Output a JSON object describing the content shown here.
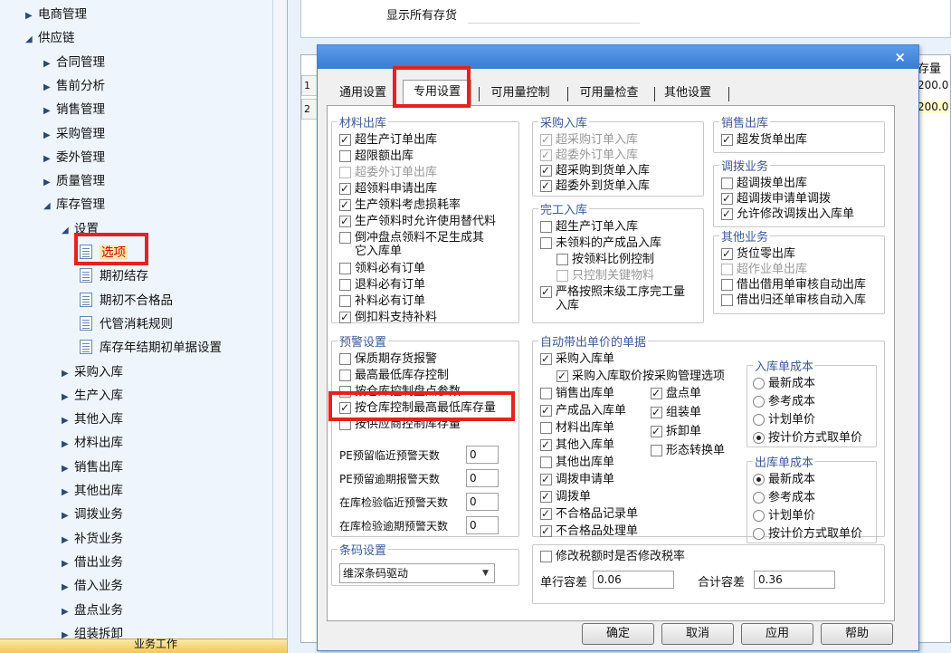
{
  "tree": {
    "items": [
      {
        "label": "电商管理",
        "arrow": "▶"
      },
      {
        "label": "供应链",
        "arrow": "◢"
      },
      {
        "label": "合同管理",
        "arrow": "▶"
      },
      {
        "label": "售前分析",
        "arrow": "▶"
      },
      {
        "label": "销售管理",
        "arrow": "▶"
      },
      {
        "label": "采购管理",
        "arrow": "▶"
      },
      {
        "label": "委外管理",
        "arrow": "▶"
      },
      {
        "label": "质量管理",
        "arrow": "▶"
      },
      {
        "label": "库存管理",
        "arrow": "◢"
      },
      {
        "label": "设置",
        "arrow": "◢"
      },
      {
        "label": "选项",
        "arrow": ""
      },
      {
        "label": "期初结存",
        "arrow": ""
      },
      {
        "label": "期初不合格品",
        "arrow": ""
      },
      {
        "label": "代管消耗规则",
        "arrow": ""
      },
      {
        "label": "库存年结期初单据设置",
        "arrow": ""
      },
      {
        "label": "采购入库",
        "arrow": "▶"
      },
      {
        "label": "生产入库",
        "arrow": "▶"
      },
      {
        "label": "其他入库",
        "arrow": "▶"
      },
      {
        "label": "材料出库",
        "arrow": "▶"
      },
      {
        "label": "销售出库",
        "arrow": "▶"
      },
      {
        "label": "其他出库",
        "arrow": "▶"
      },
      {
        "label": "调拨业务",
        "arrow": "▶"
      },
      {
        "label": "补货业务",
        "arrow": "▶"
      },
      {
        "label": "借出业务",
        "arrow": "▶"
      },
      {
        "label": "借入业务",
        "arrow": "▶"
      },
      {
        "label": "盘点业务",
        "arrow": "▶"
      },
      {
        "label": "组装拆卸",
        "arrow": "▶"
      }
    ],
    "bottom_label": "业务工作"
  },
  "background": {
    "show_all_label": "显示所有存货",
    "col_header": "存量",
    "rows": [
      {
        "num": "1",
        "value": "200.0"
      },
      {
        "num": "2",
        "value": "200.0"
      }
    ]
  },
  "dialog": {
    "close": "×",
    "tabs": [
      "通用设置",
      "专用设置",
      "可用量控制",
      "可用量检查",
      "其他设置"
    ],
    "material_out": {
      "legend": "材料出库",
      "items": [
        {
          "label": "超生产订单出库",
          "checked": true,
          "disabled": false
        },
        {
          "label": "超限额出库",
          "checked": false,
          "disabled": false
        },
        {
          "label": "超委外订单出库",
          "checked": false,
          "disabled": true
        },
        {
          "label": "超领料申请出库",
          "checked": true,
          "disabled": false
        },
        {
          "label": "生产领料考虑损耗率",
          "checked": true,
          "disabled": false
        },
        {
          "label": "生产领料时允许使用替代料",
          "checked": true,
          "disabled": false
        },
        {
          "label": "倒冲盘点领料不足生成其",
          "label2": "它入库单",
          "checked": false,
          "disabled": false
        },
        {
          "label": "领料必有订单",
          "checked": false,
          "disabled": false
        },
        {
          "label": "退料必有订单",
          "checked": false,
          "disabled": false
        },
        {
          "label": "补料必有订单",
          "checked": false,
          "disabled": false
        },
        {
          "label": "倒扣料支持补料",
          "checked": true,
          "disabled": false
        }
      ]
    },
    "purchase_in": {
      "legend": "采购入库",
      "items": [
        {
          "label": "超采购订单入库",
          "checked": true,
          "disabled": true
        },
        {
          "label": "超委外订单入库",
          "checked": true,
          "disabled": true
        },
        {
          "label": "超采购到货单入库",
          "checked": true,
          "disabled": false
        },
        {
          "label": "超委外到货单入库",
          "checked": true,
          "disabled": false
        }
      ]
    },
    "finished_in": {
      "legend": "完工入库",
      "items": [
        {
          "label": "超生产订单入库",
          "checked": false,
          "disabled": false
        },
        {
          "label": "未领料的产成品入库",
          "checked": false,
          "disabled": false
        },
        {
          "label": "按领料比例控制",
          "checked": false,
          "disabled": false
        },
        {
          "label": "只控制关键物料",
          "checked": false,
          "disabled": true
        },
        {
          "label": "严格按照末级工序完工量",
          "label2": "入库",
          "checked": true,
          "disabled": false
        }
      ]
    },
    "sales_out": {
      "legend": "销售出库",
      "items": [
        {
          "label": "超发货单出库",
          "checked": true,
          "disabled": false
        }
      ]
    },
    "transfer": {
      "legend": "调拨业务",
      "items": [
        {
          "label": "超调拨单出库",
          "checked": false,
          "disabled": false
        },
        {
          "label": "超调拨申请单调拨",
          "checked": true,
          "disabled": false
        },
        {
          "label": "允许修改调拨出入库单",
          "checked": true,
          "disabled": false
        }
      ]
    },
    "other_biz": {
      "legend": "其他业务",
      "items": [
        {
          "label": "货位零出库",
          "checked": true,
          "disabled": false
        },
        {
          "label": "超作业单出库",
          "checked": false,
          "disabled": true
        },
        {
          "label": "借出借用单审核自动出库",
          "checked": false,
          "disabled": false
        },
        {
          "label": "借出归还单审核自动入库",
          "checked": false,
          "disabled": false
        }
      ]
    },
    "warning": {
      "legend": "预警设置",
      "items": [
        {
          "label": "保质期存货报警",
          "checked": false,
          "disabled": false
        },
        {
          "label": "最高最低库存控制",
          "checked": false,
          "disabled": false
        },
        {
          "label": "按仓库控制盘点参数",
          "checked": false,
          "disabled": false
        },
        {
          "label": "按仓库控制最高最低库存量",
          "checked": true,
          "disabled": false
        },
        {
          "label": "按供应商控制库存量",
          "checked": false,
          "disabled": false
        }
      ],
      "days": [
        {
          "label": "PE预留临近预警天数",
          "value": "0"
        },
        {
          "label": "PE预留逾期报警天数",
          "value": "0"
        },
        {
          "label": "在库检验临近预警天数",
          "value": "0"
        },
        {
          "label": "在库检验逾期预警天数",
          "value": "0"
        }
      ]
    },
    "auto_price": {
      "legend": "自动带出单价的单据",
      "col1": [
        {
          "label": "采购入库单",
          "checked": true,
          "disabled": false
        },
        {
          "label": "采购入库取价按采购管理选项",
          "checked": true,
          "disabled": false
        },
        {
          "label": "销售出库单",
          "checked": false,
          "disabled": false
        },
        {
          "label": "产成品入库单",
          "checked": true,
          "disabled": false
        },
        {
          "label": "材料出库单",
          "checked": false,
          "disabled": false
        },
        {
          "label": "其他入库单",
          "checked": true,
          "disabled": false
        },
        {
          "label": "其他出库单",
          "checked": false,
          "disabled": false
        },
        {
          "label": "调拨申请单",
          "checked": true,
          "disabled": false
        },
        {
          "label": "调拨单",
          "checked": true,
          "disabled": false
        },
        {
          "label": "不合格品记录单",
          "checked": true,
          "disabled": false
        },
        {
          "label": "不合格品处理单",
          "checked": true,
          "disabled": false
        }
      ],
      "col2": [
        {
          "label": "盘点单",
          "checked": true,
          "disabled": false
        },
        {
          "label": "组装单",
          "checked": true,
          "disabled": false
        },
        {
          "label": "拆卸单",
          "checked": true,
          "disabled": false
        },
        {
          "label": "形态转换单",
          "checked": false,
          "disabled": false
        }
      ]
    },
    "in_cost": {
      "legend": "入库单成本",
      "options": [
        "最新成本",
        "参考成本",
        "计划单价",
        "按计价方式取单价"
      ],
      "selected": 3
    },
    "out_cost": {
      "legend": "出库单成本",
      "options": [
        "最新成本",
        "参考成本",
        "计划单价",
        "按计价方式取单价"
      ],
      "selected": 0
    },
    "barcode": {
      "legend": "条码设置",
      "value": "维深条码驱动"
    },
    "tax": {
      "modify_label": "修改税额时是否修改税率",
      "modify_checked": false,
      "row_tol_label": "单行容差",
      "row_tol_value": "0.06",
      "total_tol_label": "合计容差",
      "total_tol_value": "0.36"
    },
    "buttons": {
      "ok": "确定",
      "cancel": "取消",
      "apply": "应用",
      "help": "帮助"
    }
  }
}
